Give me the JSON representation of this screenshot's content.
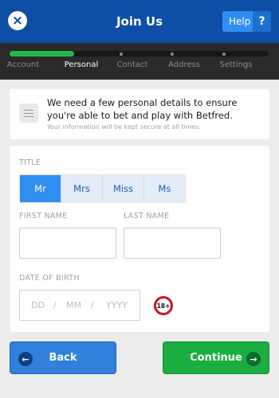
{
  "header": {
    "title": "Join Us",
    "close_icon": "×",
    "help_label": "Help",
    "help_icon": "?"
  },
  "steps": {
    "items": [
      "Account",
      "Personal",
      "Contact",
      "Address",
      "Settings"
    ],
    "active": "Personal",
    "progress": 0.25
  },
  "info": {
    "message": "We need a few personal details to ensure you're able to bet and play with Betfred.",
    "note": "Your information will be kept secure at all times."
  },
  "form": {
    "title_label": "TITLE",
    "title_options": [
      "Mr",
      "Mrs",
      "Miss",
      "Ms"
    ],
    "title_selected": "Mr",
    "first_name_label": "FIRST NAME",
    "last_name_label": "LAST NAME",
    "first_name_value": "",
    "last_name_value": "",
    "dob_label": "DATE OF BIRTH",
    "dob_placeholders": {
      "day": "DD",
      "month": "MM",
      "year": "YYYY"
    },
    "dob_separator": "/",
    "age_badge": "18+"
  },
  "actions": {
    "back_label": "Back",
    "continue_label": "Continue",
    "back_icon": "←",
    "continue_icon": "→"
  },
  "colors": {
    "brand": "#0d4ea6",
    "accent": "#2f8ff0",
    "success": "#1aae3f",
    "warning_ring": "#c9141f"
  }
}
